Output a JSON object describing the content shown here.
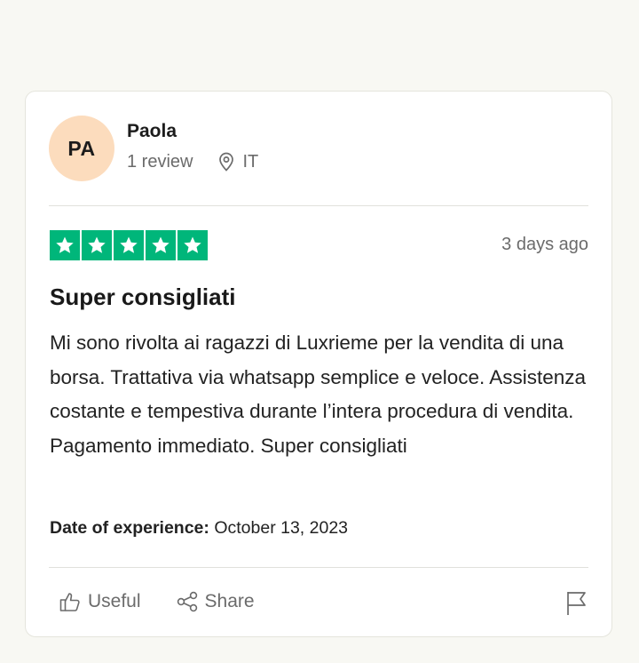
{
  "reviewer": {
    "initials": "PA",
    "name": "Paola",
    "review_count": "1 review",
    "country": "IT"
  },
  "review": {
    "rating": 5,
    "max_rating": 5,
    "star_color": "#00b67a",
    "date_ago": "3 days ago",
    "title": "Super consigliati",
    "body": "Mi sono rivolta ai ragazzi di Luxrieme per la vendita di una borsa. Trattativa via whatsapp semplice e veloce. Assistenza costante e tempestiva durante l’intera procedura di vendita. Pagamento immediato. Super consigliati",
    "experience_label": "Date of experience:",
    "experience_date": "October 13, 2023"
  },
  "actions": {
    "useful_label": "Useful",
    "share_label": "Share"
  },
  "icons": {
    "location": "map-pin-icon",
    "useful": "thumbs-up-icon",
    "share": "share-icon",
    "report": "flag-icon",
    "star": "star-icon"
  }
}
